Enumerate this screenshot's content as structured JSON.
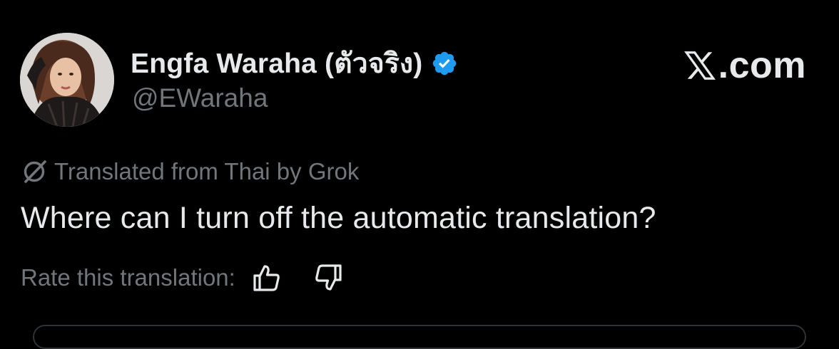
{
  "tweet": {
    "author": {
      "display_name": "Engfa Waraha (ตัวจริง)",
      "handle": "@EWaraha",
      "verified": true,
      "verified_color": "#1d9bf0",
      "avatar_icon": "profile-photo"
    },
    "brand": {
      "icon": "x-logo-icon",
      "text": ".com"
    },
    "translation_notice": {
      "icon": "grok-icon",
      "text": "Translated from Thai by Grok"
    },
    "text": "Where can I turn off the automatic translation?",
    "rating": {
      "label": "Rate this translation:",
      "thumbs_up_icon": "thumbs-up-icon",
      "thumbs_down_icon": "thumbs-down-icon"
    }
  },
  "colors": {
    "background": "#000000",
    "primary_text": "#e7e9ea",
    "secondary_text": "#71767b",
    "border": "#2f3336"
  }
}
